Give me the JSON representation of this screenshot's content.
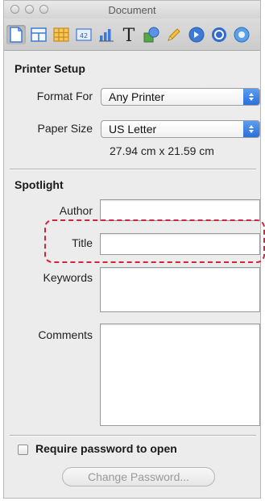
{
  "window": {
    "title": "Document"
  },
  "toolbar": {
    "icons": [
      "document-icon",
      "layout-icon",
      "table-icon",
      "cell-format-icon",
      "chart-icon",
      "text-icon",
      "shapes-icon",
      "pencil-icon",
      "link-icon",
      "quicktime-icon"
    ]
  },
  "printer_setup": {
    "heading": "Printer Setup",
    "format_for_label": "Format For",
    "format_for_value": "Any Printer",
    "paper_size_label": "Paper Size",
    "paper_size_value": "US Letter",
    "paper_dimensions": "27.94 cm x 21.59 cm"
  },
  "spotlight": {
    "heading": "Spotlight",
    "author_label": "Author",
    "author_value": "",
    "title_label": "Title",
    "title_value": "",
    "keywords_label": "Keywords",
    "keywords_value": "",
    "comments_label": "Comments",
    "comments_value": ""
  },
  "security": {
    "require_password_label": "Require password to open",
    "require_password_checked": false,
    "change_password_label": "Change Password..."
  },
  "colors": {
    "highlight": "#d2243c",
    "popup_accent": "#2a6fda"
  }
}
